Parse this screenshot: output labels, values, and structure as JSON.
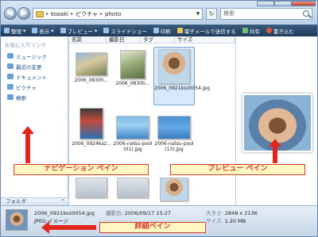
{
  "address": {
    "segments": [
      "kozaki",
      "ピクチャ",
      "photo"
    ]
  },
  "search": {
    "placeholder": "検索"
  },
  "toolbar": {
    "organize": "整理",
    "view": "表示",
    "preview": "プレビュー",
    "slideshow": "スライドショー",
    "print": "印刷",
    "email": "電子メールで送信する",
    "share": "共有",
    "burn": "書き込む"
  },
  "nav": {
    "header": "お気に入りリンク",
    "items": [
      "ミュージック",
      "最近の変更",
      "ドキュメント",
      "ピクチャ",
      "検索"
    ],
    "folder_label": "フォルダ"
  },
  "columns": [
    "名前",
    "撮影日",
    "タグ",
    "サイズ"
  ],
  "files": [
    {
      "name": "2006_0830h...",
      "selected": false
    },
    {
      "name": "2006_0830h...",
      "selected": false
    },
    {
      "name": "2006_0921koz0054.jpg",
      "selected": true
    },
    {
      "name": "2006_0924kaz...",
      "selected": false
    },
    {
      "name": "2006-natsu-pool (01).jpg",
      "selected": false
    },
    {
      "name": "2006-natsu-pool (13).jpg",
      "selected": false
    }
  ],
  "details": {
    "filename": "2006_0921koz0054.jpg",
    "date_label": "撮影日:",
    "date_value": "2006/09/17 15:27",
    "size_label": "大きさ:",
    "size_value": "2848 x 2136",
    "type": "JPEG イメージ",
    "filesize_label": "サイズ:",
    "filesize_value": "1.20 MB"
  },
  "annotations": {
    "nav_pane": "ナビゲーション ペイン",
    "preview_pane": "プレビュー ペイン",
    "details_pane": "詳細ペイン"
  },
  "colors": {
    "accent": "#d63c2a",
    "callout_bg": "#fff7c2",
    "toolbar": "#2a4a6e"
  }
}
